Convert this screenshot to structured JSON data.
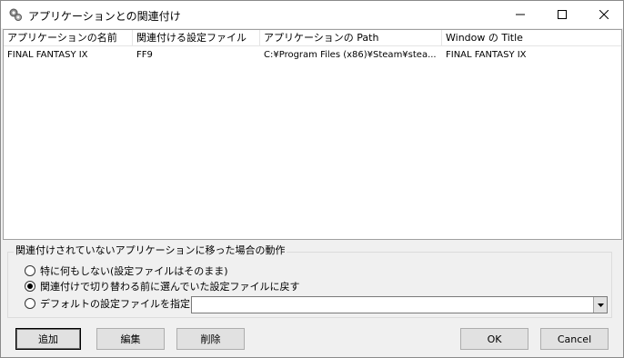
{
  "window": {
    "title": "アプリケーションとの関連付け",
    "icon": "gear-app-icon"
  },
  "list": {
    "columns": [
      "アプリケーションの名前",
      "関連付ける設定ファイル",
      "アプリケーションの Path",
      "Window の Title"
    ],
    "rows": [
      [
        "FINAL FANTASY IX",
        "FF9",
        "C:¥Program Files (x86)¥Steam¥stea...",
        "FINAL FANTASY IX"
      ]
    ]
  },
  "behavior": {
    "legend": "関連付けされていないアプリケーションに移った場合の動作",
    "options": [
      {
        "label": "特に何もしない(設定ファイルはそのまま)",
        "checked": false
      },
      {
        "label": "関連付けで切り替わる前に選んでいた設定ファイルに戻す",
        "checked": true
      },
      {
        "label": "デフォルトの設定ファイルを指定",
        "checked": false
      }
    ],
    "default_file_value": ""
  },
  "buttons": {
    "add": "追加",
    "edit": "編集",
    "delete": "削除",
    "ok": "OK",
    "cancel": "Cancel"
  }
}
